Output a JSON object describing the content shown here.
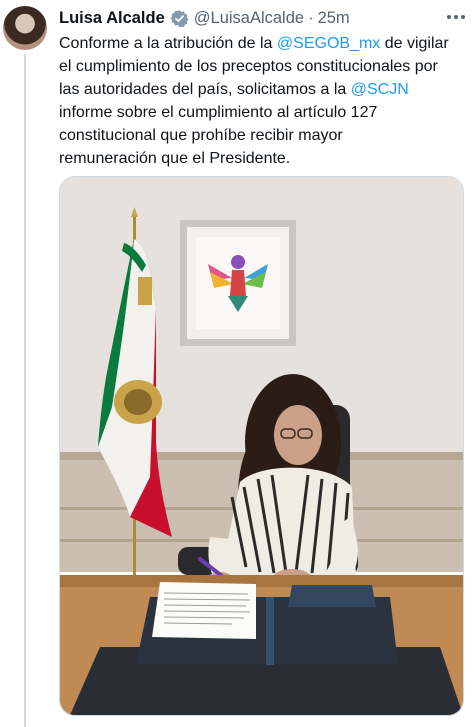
{
  "author": {
    "name": "Luisa Alcalde",
    "handle": "@LuisaAlcalde",
    "separator": "·",
    "time": "25m",
    "verified_icon": "verified-badge-icon"
  },
  "tweet": {
    "lines": [
      {
        "a": "Conforme a la atribución de la ",
        "m": "@SEGOB_mx",
        "b": " de vigilar"
      },
      {
        "a": "el cumplimiento de los preceptos constitucionales por",
        "m": "",
        "b": ""
      },
      {
        "a": "las autoridades del país, solicitamos a la ",
        "m": "@SCJN",
        "b": ""
      },
      {
        "a": "informe sobre el cumplimiento al artículo 127",
        "m": "",
        "b": ""
      },
      {
        "a": "constitucional que prohíbe recibir mayor",
        "m": "",
        "b": ""
      },
      {
        "a": "remuneración que el Presidente.",
        "m": "",
        "b": ""
      }
    ]
  },
  "icons": {
    "more": "more-options-icon"
  },
  "colors": {
    "link": "#1d9bf0",
    "secondary_text": "#536471",
    "verified": "#829aab",
    "border": "#cfd9de"
  }
}
